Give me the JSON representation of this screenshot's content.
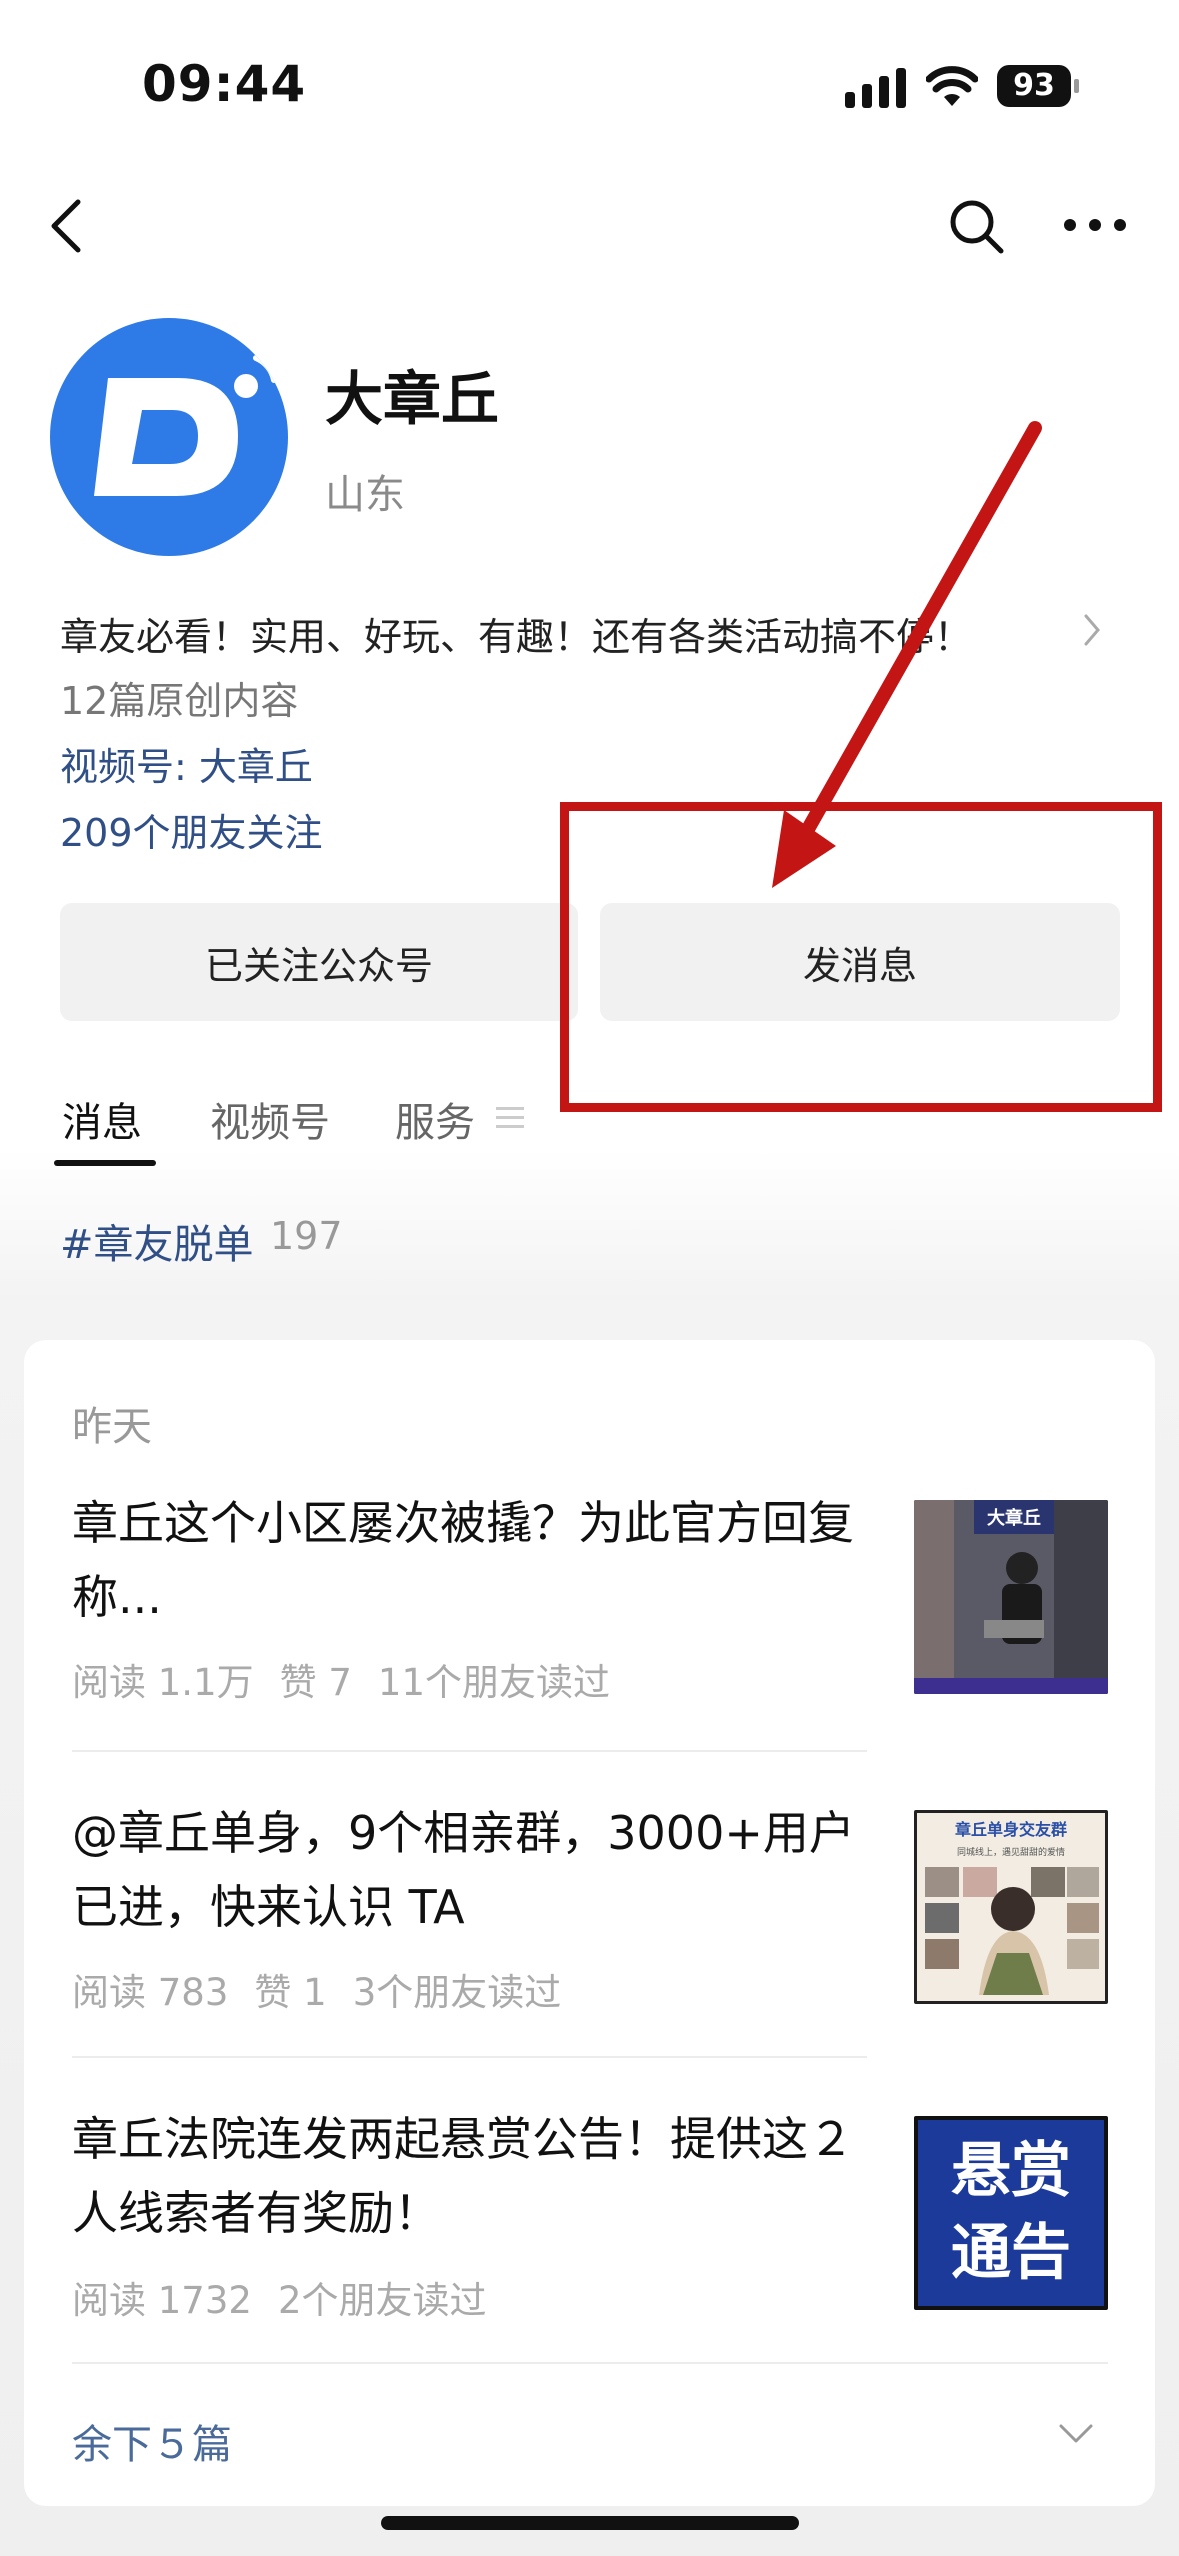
{
  "status_bar": {
    "time": "09:44",
    "battery": "93"
  },
  "nav": {
    "back_icon": "chevron-left-icon",
    "search_icon": "search-icon",
    "more_icon": "ellipsis-icon"
  },
  "profile": {
    "logo_letter": "D",
    "name": "大章丘",
    "location": "山东",
    "description": "章友必看！实用、好玩、有趣！还有各类活动搞不停！",
    "original_count": "12篇原创内容",
    "channel_link": "视频号: 大章丘",
    "friends_follow": "209个朋友关注"
  },
  "actions": {
    "followed": "已关注公众号",
    "send_message": "发消息"
  },
  "tabs": [
    {
      "label": "消息"
    },
    {
      "label": "视频号"
    },
    {
      "label": "服务"
    }
  ],
  "hashtag": {
    "label": "#章友脱单",
    "count": "197"
  },
  "feed": {
    "date_label": "昨天",
    "articles": [
      {
        "title": "章丘这个小区屡次被撬？为此官方回复称...",
        "reads": "阅读 1.1万",
        "likes": "赞 7",
        "friends": "11个朋友读过",
        "thumb_label": "大章丘"
      },
      {
        "title": "@章丘单身，9个相亲群，3000+用户已进，快来认识 TA",
        "reads": "阅读 783",
        "likes": "赞 1",
        "friends": "3个朋友读过",
        "thumb_label": "章丘单身交友群",
        "thumb_sublabel": "同城线上，遇见甜甜的爱情"
      },
      {
        "title": "章丘法院连发两起悬赏公告！提供这２人线索者有奖励！",
        "reads": "阅读 1732",
        "friends": "2个朋友读过",
        "thumb_line1": "悬赏",
        "thumb_line2": "通告"
      }
    ],
    "remaining": "余下５篇"
  },
  "colors": {
    "brand_blue": "#2e7be8",
    "link_blue": "#2f4f86",
    "annotation_red": "#c41515"
  }
}
